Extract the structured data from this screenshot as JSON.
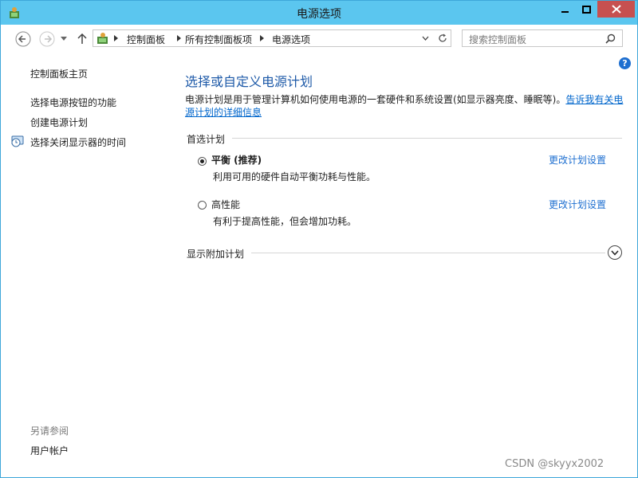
{
  "window": {
    "title": "电源选项"
  },
  "breadcrumb": [
    "控制面板",
    "所有控制面板项",
    "电源选项"
  ],
  "search": {
    "placeholder": "搜索控制面板"
  },
  "sidebar": {
    "home": "控制面板主页",
    "links": [
      "选择电源按钮的功能",
      "创建电源计划",
      "选择关闭显示器的时间"
    ],
    "see_also_heading": "另请参阅",
    "see_also_links": [
      "用户帐户"
    ]
  },
  "main": {
    "heading": "选择或自定义电源计划",
    "description": "电源计划是用于管理计算机如何使用电源的一套硬件和系统设置(如显示器亮度、睡眠等)。",
    "learn_more_link": "告诉我有关电源计划的详细信息",
    "preferred_section": "首选计划",
    "plans": [
      {
        "name": "平衡 (推荐)",
        "description": "利用可用的硬件自动平衡功耗与性能。",
        "selected": true,
        "link": "更改计划设置"
      },
      {
        "name": "高性能",
        "description": "有利于提高性能，但会增加功耗。",
        "selected": false,
        "link": "更改计划设置"
      }
    ],
    "additional_section": "显示附加计划"
  },
  "watermark": "CSDN @skyyx2002",
  "colors": {
    "titlebar": "#5bc6ef",
    "close_button": "#c75050",
    "link": "#1e6fd0",
    "heading": "#1e5aa8"
  }
}
